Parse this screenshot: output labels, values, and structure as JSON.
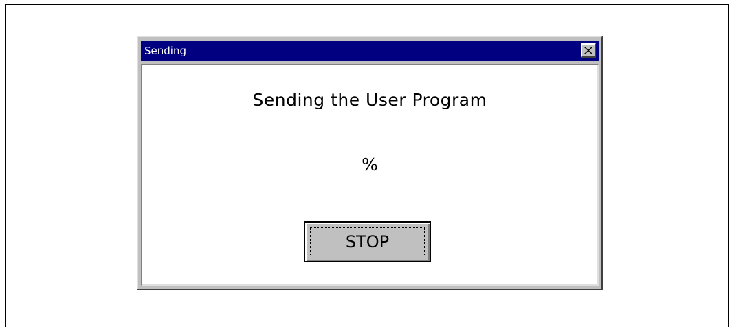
{
  "dialog": {
    "title": "Sending",
    "message": "Sending the User Program",
    "progress_text": "%",
    "stop_label": "STOP"
  },
  "colors": {
    "titlebar": "#000080",
    "face": "#c0c0c0",
    "client": "#ffffff"
  },
  "icons": {
    "close": "close-icon"
  }
}
